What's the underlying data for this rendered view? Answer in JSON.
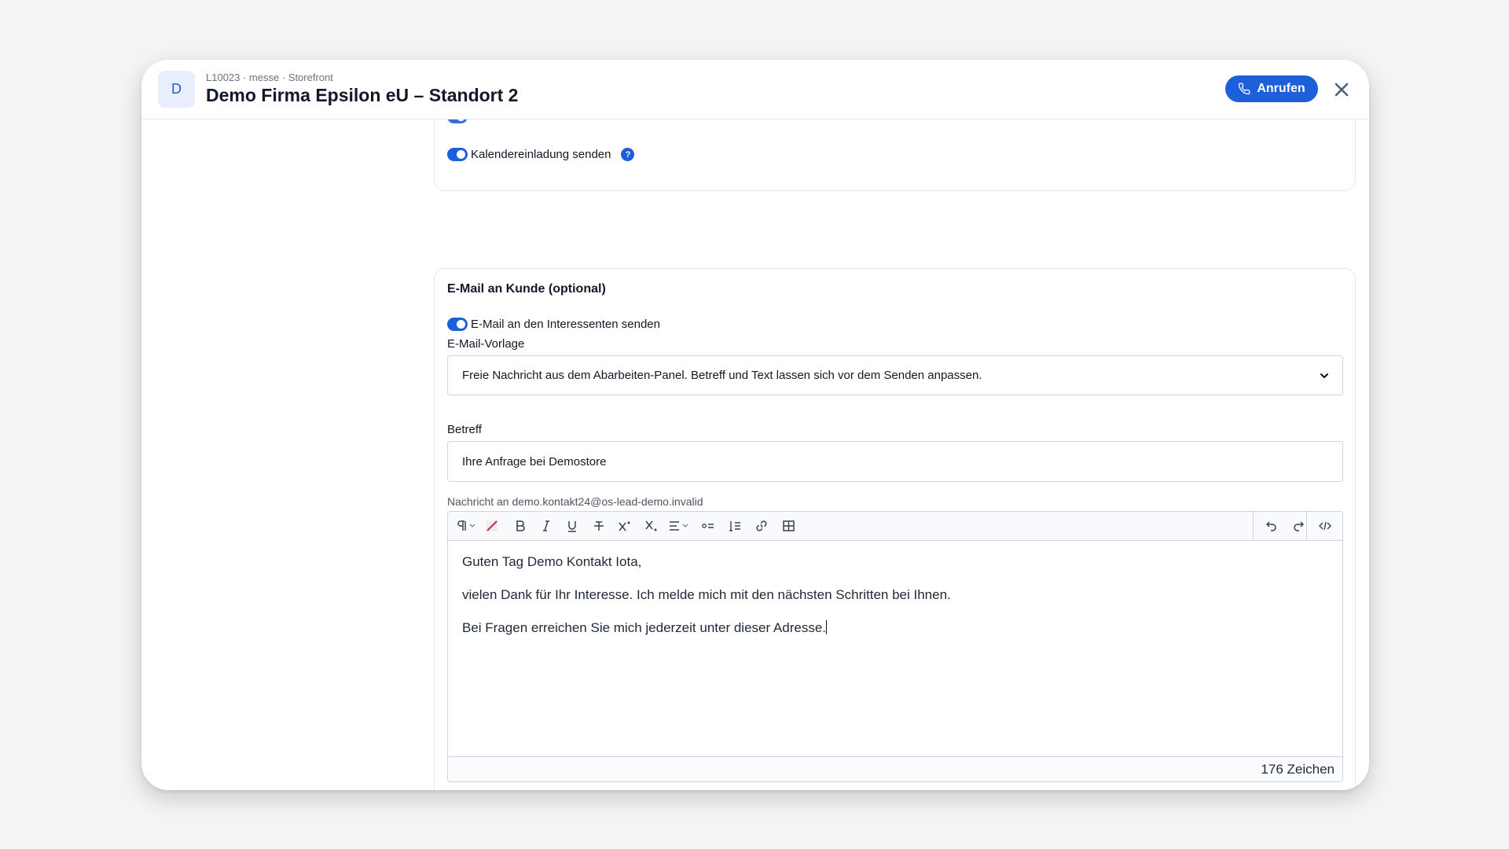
{
  "header": {
    "avatar_letter": "D",
    "breadcrumb": "L10023 · messe · Storefront",
    "title": "Demo Firma Epsilon eU – Standort 2",
    "call_label": "Anrufen"
  },
  "settings": {
    "toggle_calendar_label": "Kalendereinladung senden",
    "help_glyph": "?"
  },
  "email_section": {
    "title": "E-Mail an Kunde (optional)",
    "toggle_label": "E-Mail an den Interessenten senden",
    "template_label": "E-Mail-Vorlage",
    "template_value": "Freie Nachricht aus dem Abarbeiten-Panel. Betreff und Text lassen sich vor dem Senden anpassen.",
    "subject_label": "Betreff",
    "subject_value": "Ihre Anfrage bei Demostore",
    "message_label": "Nachricht an demo.kontakt24@os-lead-demo.invalid",
    "message_lines": [
      "Guten Tag Demo Kontakt Iota,",
      "vielen Dank für Ihr Interesse. Ich melde mich mit den nächsten Schritten bei Ihnen.",
      "Bei Fragen erreichen Sie mich jederzeit unter dieser Adresse."
    ],
    "char_count": "176 Zeichen"
  },
  "toolbar": {
    "icons": [
      "paragraph-icon",
      "clear-format-icon",
      "bold-icon",
      "italic-icon",
      "underline-icon",
      "strikethrough-icon",
      "superscript-icon",
      "subscript-icon",
      "align-icon",
      "bullet-list-icon",
      "numbered-list-icon",
      "link-icon",
      "table-icon",
      "undo-icon",
      "redo-icon",
      "code-view-icon"
    ]
  },
  "colors": {
    "accent": "#1d5fdb",
    "border": "#d1d5db"
  }
}
